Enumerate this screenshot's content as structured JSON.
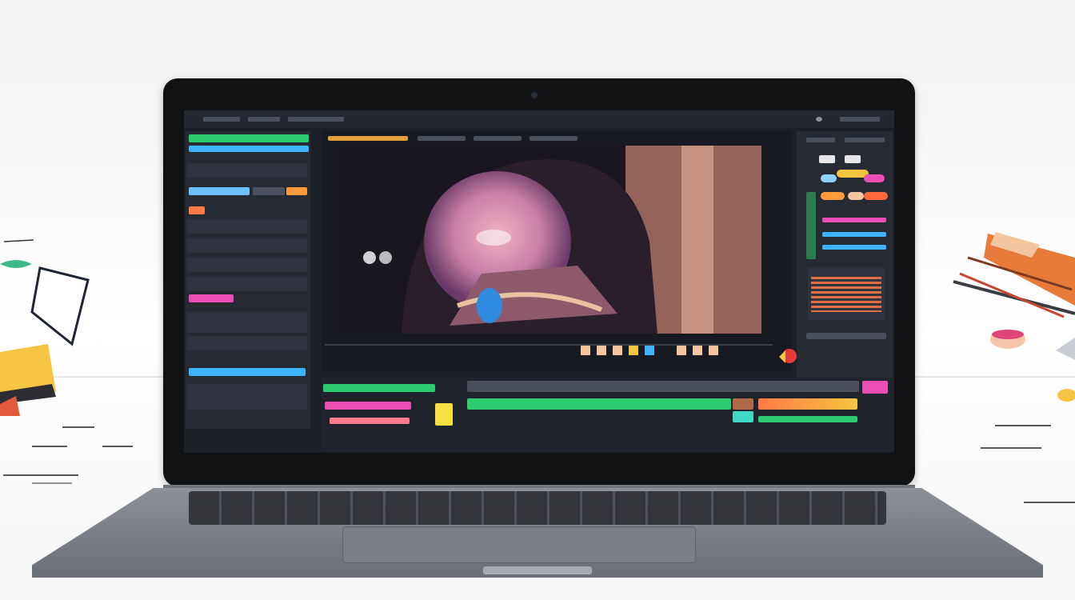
{
  "scene": {
    "type": "photo-illustration",
    "subject": "laptop",
    "accent_colors": [
      "#2ecc71",
      "#ff7a45",
      "#e94fb3",
      "#3fb3ff",
      "#f5c542"
    ]
  },
  "icons": {
    "camera": "camera-dot-icon",
    "playhead": "playhead-icon",
    "record": "record-icon",
    "paint_brushes": "paint-brush-icon"
  }
}
